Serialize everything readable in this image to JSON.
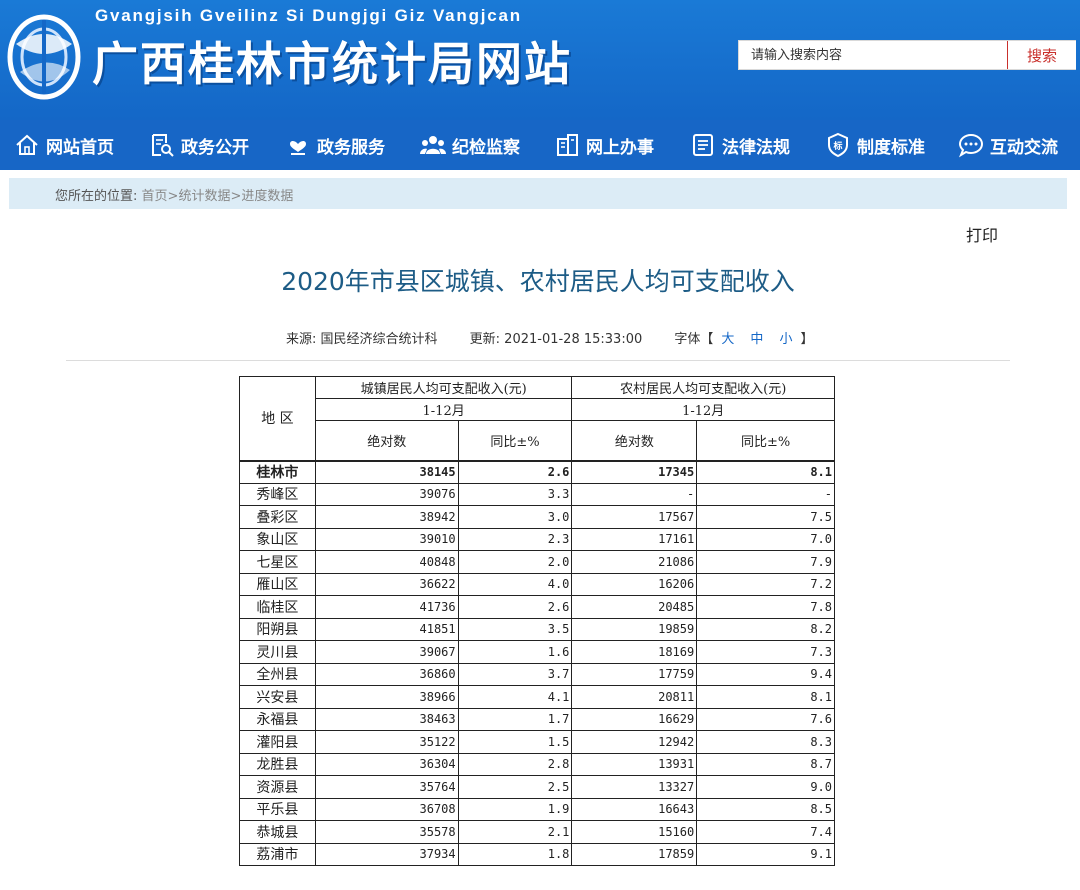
{
  "header": {
    "pinyin": "Gvangjsih Gveilinz Si Dungjgi Giz Vangjcan",
    "title": "广西桂林市统计局网站",
    "search_placeholder": "请输入搜索内容",
    "search_button": "搜索",
    "brand_color": "#1467c7"
  },
  "nav": [
    {
      "label": "网站首页",
      "icon": "home-icon"
    },
    {
      "label": "政务公开",
      "icon": "document-search-icon"
    },
    {
      "label": "政务服务",
      "icon": "heart-hand-icon"
    },
    {
      "label": "纪检监察",
      "icon": "people-icon"
    },
    {
      "label": "网上办事",
      "icon": "office-icon"
    },
    {
      "label": "法律法规",
      "icon": "list-icon"
    },
    {
      "label": "制度标准",
      "icon": "shield-badge-icon"
    },
    {
      "label": "互动交流",
      "icon": "chat-icon"
    }
  ],
  "breadcrumb": {
    "prefix": "您所在的位置:",
    "items": [
      "首页",
      "统计数据",
      "进度数据"
    ],
    "separator": ">"
  },
  "print_label": "打印",
  "article": {
    "title": "2020年市县区城镇、农村居民人均可支配收入",
    "source_label": "来源: 国民经济综合统计科",
    "updated_label": "更新: 2021-01-28 15:33:00",
    "font_label": "字体【",
    "font_sizes": [
      "大",
      "中",
      "小"
    ],
    "font_close": "】"
  },
  "table": {
    "region_header": "地 区",
    "urban_header": "城镇居民人均可支配收入(元)",
    "rural_header": "农村居民人均可支配收入(元)",
    "period": "1-12月",
    "abs_header": "绝对数",
    "yoy_header": "同比±%",
    "rows": [
      {
        "name": "桂林市",
        "u_abs": "38145",
        "u_yoy": "2.6",
        "r_abs": "17345",
        "r_yoy": "8.1"
      },
      {
        "name": "秀峰区",
        "u_abs": "39076",
        "u_yoy": "3.3",
        "r_abs": "-",
        "r_yoy": "-"
      },
      {
        "name": "叠彩区",
        "u_abs": "38942",
        "u_yoy": "3.0",
        "r_abs": "17567",
        "r_yoy": "7.5"
      },
      {
        "name": "象山区",
        "u_abs": "39010",
        "u_yoy": "2.3",
        "r_abs": "17161",
        "r_yoy": "7.0"
      },
      {
        "name": "七星区",
        "u_abs": "40848",
        "u_yoy": "2.0",
        "r_abs": "21086",
        "r_yoy": "7.9"
      },
      {
        "name": "雁山区",
        "u_abs": "36622",
        "u_yoy": "4.0",
        "r_abs": "16206",
        "r_yoy": "7.2"
      },
      {
        "name": "临桂区",
        "u_abs": "41736",
        "u_yoy": "2.6",
        "r_abs": "20485",
        "r_yoy": "7.8"
      },
      {
        "name": "阳朔县",
        "u_abs": "41851",
        "u_yoy": "3.5",
        "r_abs": "19859",
        "r_yoy": "8.2"
      },
      {
        "name": "灵川县",
        "u_abs": "39067",
        "u_yoy": "1.6",
        "r_abs": "18169",
        "r_yoy": "7.3"
      },
      {
        "name": "全州县",
        "u_abs": "36860",
        "u_yoy": "3.7",
        "r_abs": "17759",
        "r_yoy": "9.4"
      },
      {
        "name": "兴安县",
        "u_abs": "38966",
        "u_yoy": "4.1",
        "r_abs": "20811",
        "r_yoy": "8.1"
      },
      {
        "name": "永福县",
        "u_abs": "38463",
        "u_yoy": "1.7",
        "r_abs": "16629",
        "r_yoy": "7.6"
      },
      {
        "name": "灌阳县",
        "u_abs": "35122",
        "u_yoy": "1.5",
        "r_abs": "12942",
        "r_yoy": "8.3"
      },
      {
        "name": "龙胜县",
        "u_abs": "36304",
        "u_yoy": "2.8",
        "r_abs": "13931",
        "r_yoy": "8.7"
      },
      {
        "name": "资源县",
        "u_abs": "35764",
        "u_yoy": "2.5",
        "r_abs": "13327",
        "r_yoy": "9.0"
      },
      {
        "name": "平乐县",
        "u_abs": "36708",
        "u_yoy": "1.9",
        "r_abs": "16643",
        "r_yoy": "8.5"
      },
      {
        "name": "恭城县",
        "u_abs": "35578",
        "u_yoy": "2.1",
        "r_abs": "15160",
        "r_yoy": "7.4"
      },
      {
        "name": "荔浦市",
        "u_abs": "37934",
        "u_yoy": "1.8",
        "r_abs": "17859",
        "r_yoy": "9.1"
      }
    ]
  }
}
